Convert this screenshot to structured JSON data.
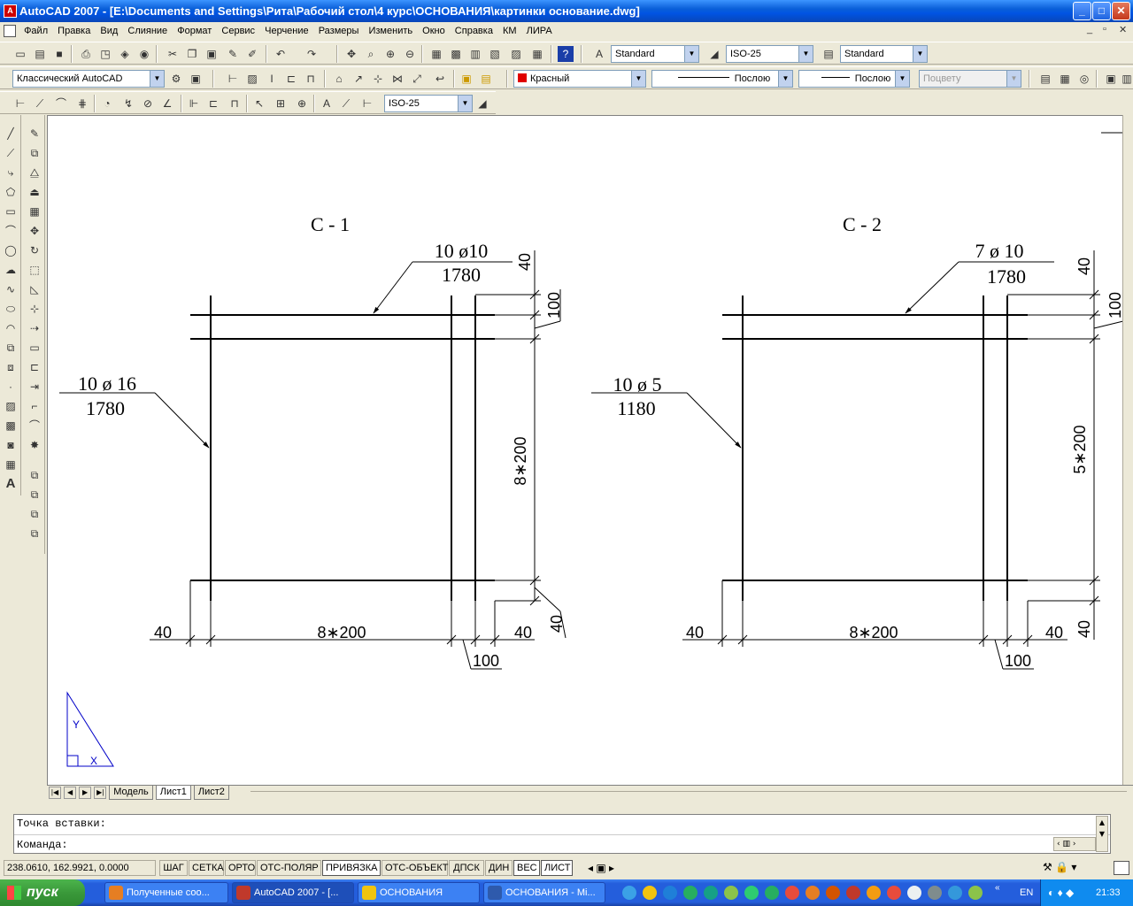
{
  "window": {
    "title": "AutoCAD 2007 - [E:\\Documents and Settings\\Рита\\Рабочий стол\\4 курс\\ОСНОВАНИЯ\\картинки основание.dwg]",
    "minimize": "_",
    "maximize": "□",
    "close": "✕"
  },
  "menu": [
    "Файл",
    "Правка",
    "Вид",
    "Слияние",
    "Формат",
    "Сервис",
    "Черчение",
    "Размеры",
    "Изменить",
    "Окно",
    "Справка",
    "КМ",
    "ЛИРА"
  ],
  "toolbar1": {
    "text_style": "Standard",
    "dim_style": "ISO-25",
    "table_style": "Standard"
  },
  "toolbar2": {
    "workspace": "Классический AutoCAD",
    "color": "Красный",
    "color_hex": "#e00000",
    "linetype": "Послою",
    "lineweight": "Послою",
    "plotstyle": "Поцвету"
  },
  "toolbar3": {
    "dim_style": "ISO-25"
  },
  "drawing": {
    "c1": {
      "title": "С - 1",
      "top_label_1": "10 ø10",
      "top_label_2": "1780",
      "side_label_1": "10 ø 16",
      "side_label_2": "1780",
      "dim_vert": "8∗200",
      "dim_horz": "8∗200",
      "dim_40_left": "40",
      "dim_40_right": "40",
      "dim_100_bottom": "100",
      "dim_40_top": "40",
      "dim_100_top": "100",
      "dim_40_bottom_right": "40"
    },
    "c2": {
      "title": "С - 2",
      "top_label_1": "7 ø 10",
      "top_label_2": "1780",
      "side_label_1": "10 ø 5",
      "side_label_2": "1180",
      "dim_vert": "5∗200",
      "dim_horz": "8∗200",
      "dim_40_left": "40",
      "dim_40_right": "40",
      "dim_100_bottom": "100",
      "dim_40_top": "40",
      "dim_100_top": "100",
      "dim_40_bottom_right": "40"
    },
    "ucs_y": "Y",
    "ucs_x": "X"
  },
  "tabs": {
    "nav": [
      "|◀",
      "◀",
      "▶",
      "▶|"
    ],
    "items": [
      "Модель",
      "Лист1",
      "Лист2"
    ],
    "active": "Лист1"
  },
  "command": {
    "line1": "Точка вставки:",
    "line2": "Команда:"
  },
  "status": {
    "coords": "238.0610, 162.9921, 0.0000",
    "buttons": [
      "ШАГ",
      "СЕТКА",
      "ОРТО",
      "ОТС-ПОЛЯР",
      "ПРИВЯЗКА",
      "ОТС-ОБЪЕКТ",
      "ДПСК",
      "ДИН",
      "ВЕС",
      "ЛИСТ"
    ],
    "active": [
      "ПРИВЯЗКА",
      "ВЕС",
      "ЛИСТ"
    ]
  },
  "taskbar": {
    "start": "пуск",
    "tasks": [
      "Полученные соо...",
      "AutoCAD 2007 - [...",
      "ОСНОВАНИЯ",
      "ОСНОВАНИЯ - Mi..."
    ],
    "active_task": "AutoCAD 2007 - [...",
    "lang": "EN",
    "time": "21:33"
  }
}
